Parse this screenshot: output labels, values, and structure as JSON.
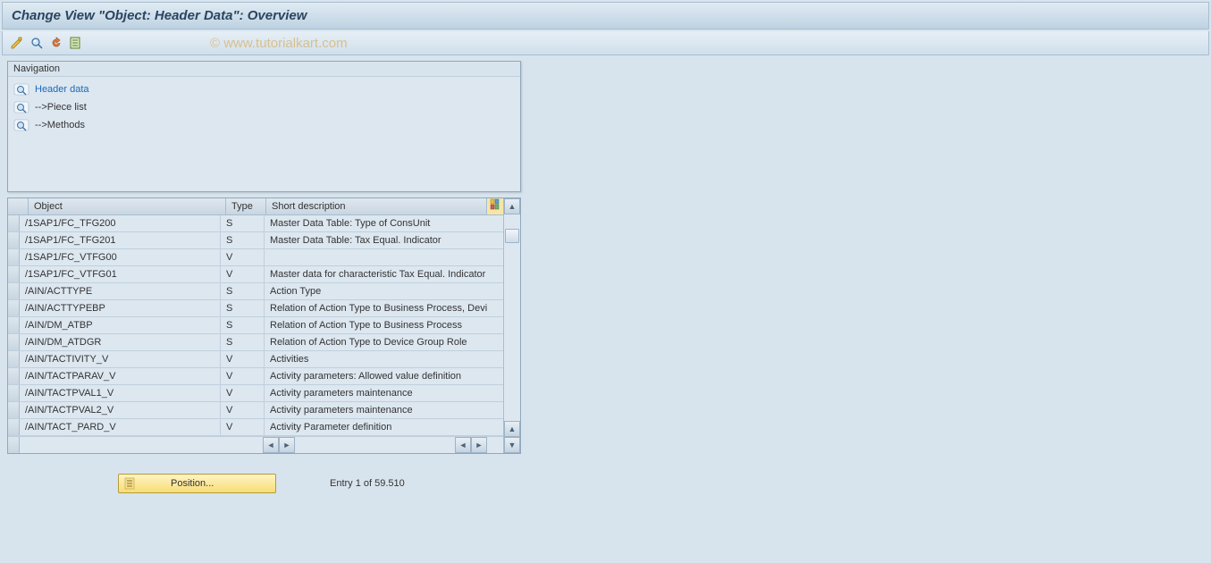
{
  "title": "Change View \"Object: Header Data\": Overview",
  "watermark": "© www.tutorialkart.com",
  "navigation": {
    "title": "Navigation",
    "items": [
      {
        "label": "Header data",
        "selected": true
      },
      {
        "label": "-->Piece list",
        "selected": false
      },
      {
        "label": "-->Methods",
        "selected": false
      }
    ]
  },
  "table": {
    "columns": {
      "object": "Object",
      "type": "Type",
      "desc": "Short description"
    },
    "rows": [
      {
        "object": "/1SAP1/FC_TFG200",
        "type": "S",
        "desc": "Master Data Table: Type of ConsUnit"
      },
      {
        "object": "/1SAP1/FC_TFG201",
        "type": "S",
        "desc": "Master Data Table: Tax Equal. Indicator"
      },
      {
        "object": "/1SAP1/FC_VTFG00",
        "type": "V",
        "desc": ""
      },
      {
        "object": "/1SAP1/FC_VTFG01",
        "type": "V",
        "desc": "Master data for characteristic Tax Equal. Indicator"
      },
      {
        "object": "/AIN/ACTTYPE",
        "type": "S",
        "desc": "Action Type"
      },
      {
        "object": "/AIN/ACTTYPEBP",
        "type": "S",
        "desc": "Relation of Action Type to Business Process, Devi"
      },
      {
        "object": "/AIN/DM_ATBP",
        "type": "S",
        "desc": "Relation of Action Type to Business Process"
      },
      {
        "object": "/AIN/DM_ATDGR",
        "type": "S",
        "desc": "Relation of Action Type to Device Group Role"
      },
      {
        "object": "/AIN/TACTIVITY_V",
        "type": "V",
        "desc": "Activities"
      },
      {
        "object": "/AIN/TACTPARAV_V",
        "type": "V",
        "desc": "Activity parameters: Allowed value definition"
      },
      {
        "object": "/AIN/TACTPVAL1_V",
        "type": "V",
        "desc": "Activity parameters maintenance"
      },
      {
        "object": "/AIN/TACTPVAL2_V",
        "type": "V",
        "desc": "Activity parameters maintenance"
      },
      {
        "object": "/AIN/TACT_PARD_V",
        "type": "V",
        "desc": "Activity Parameter definition"
      }
    ]
  },
  "footer": {
    "position_label": "Position...",
    "entry_text": "Entry 1 of 59.510"
  }
}
